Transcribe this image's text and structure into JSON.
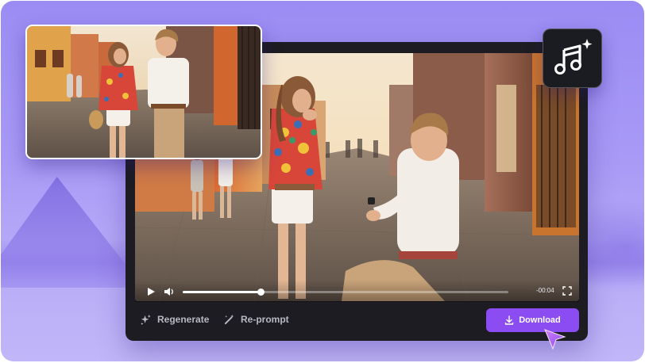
{
  "player": {
    "time": "-00:04",
    "progress": 0.24
  },
  "toolbar": {
    "regenerate_label": "Regenerate",
    "reprompt_label": "Re-prompt",
    "download_label": "Download"
  },
  "colors": {
    "background": "#a99af6",
    "editor": "#1c1c22",
    "download_button": "#8b4cf2",
    "cursor": "#b36af7"
  },
  "icons": {
    "music": "music-note-sparkle-icon",
    "play": "play-icon",
    "volume": "volume-icon",
    "fullscreen": "fullscreen-icon",
    "regenerate": "sparkle-icon",
    "reprompt": "magic-wand-icon",
    "download": "download-icon",
    "pointer": "cursor-arrow-icon"
  }
}
